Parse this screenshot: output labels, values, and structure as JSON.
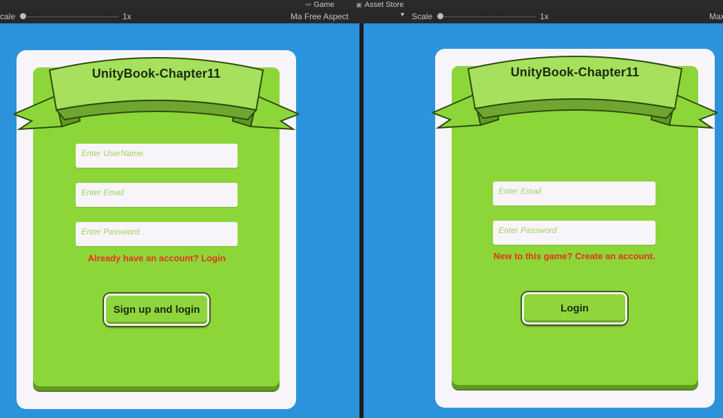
{
  "editor": {
    "tabs": [
      {
        "label": "Game",
        "icon": "gamepad-icon"
      },
      {
        "label": "Asset Store",
        "icon": "asset-store-icon"
      }
    ],
    "left_toolbar": {
      "scale_label": "cale",
      "scale_value": "1x",
      "max_label": "Ma"
    },
    "right_toolbar": {
      "aspect_label": "Free Aspect",
      "scale_label": "Scale",
      "scale_value": "1x",
      "max_label": "Max"
    }
  },
  "colors": {
    "background": "#2b93dc",
    "panel": "#f8f5fa",
    "card": "#8dd63a",
    "link": "#e8321a"
  },
  "signup": {
    "title": "UnityBook-Chapter11",
    "username_placeholder": "Enter UserName.",
    "email_placeholder": "Enter Email",
    "password_placeholder": "Enter Password .",
    "switch_link": "Already have an account? Login",
    "submit_label": "Sign up and login"
  },
  "login": {
    "title": "UnityBook-Chapter11",
    "email_placeholder": "Enter Email",
    "password_placeholder": "Enter Password",
    "switch_link": "New to this game? Create an account.",
    "submit_label": "Login"
  }
}
